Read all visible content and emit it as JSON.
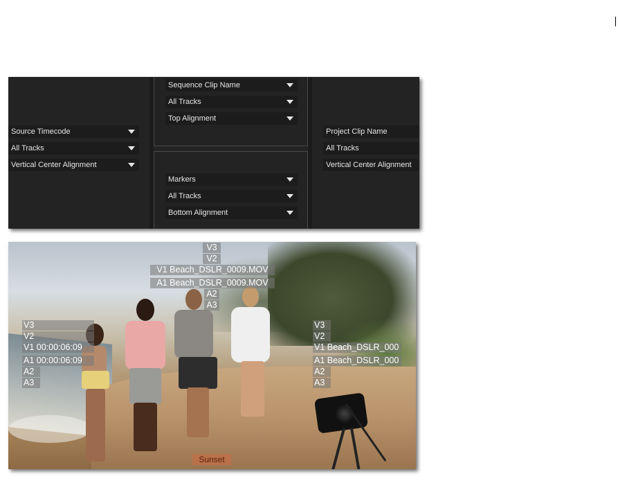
{
  "settings": {
    "left": {
      "source": "Source Timecode",
      "tracks": "All Tracks",
      "alignment": "Vertical Center Alignment"
    },
    "top_center": {
      "source": "Sequence Clip Name",
      "tracks": "All Tracks",
      "alignment": "Top Alignment"
    },
    "bottom_center": {
      "source": "Markers",
      "tracks": "All Tracks",
      "alignment": "Bottom Alignment"
    },
    "right": {
      "source": "Project Clip Name",
      "tracks": "All Tracks",
      "alignment": "Vertical Center Alignment"
    }
  },
  "overlay": {
    "top": [
      "V3",
      "V2",
      "V1 Beach_DSLR_0009.MOV",
      "A1 Beach_DSLR_0009.MOV",
      "A2",
      "A3"
    ],
    "left": [
      "V3",
      "V2",
      "V1 00:00:06:09",
      "A1 00:00:06:09",
      "A2",
      "A3"
    ],
    "right": [
      "V3",
      "V2",
      "V1 Beach_DSLR_000",
      "A1 Beach_DSLR_000",
      "A2",
      "A3"
    ],
    "marker": "Sunset"
  }
}
